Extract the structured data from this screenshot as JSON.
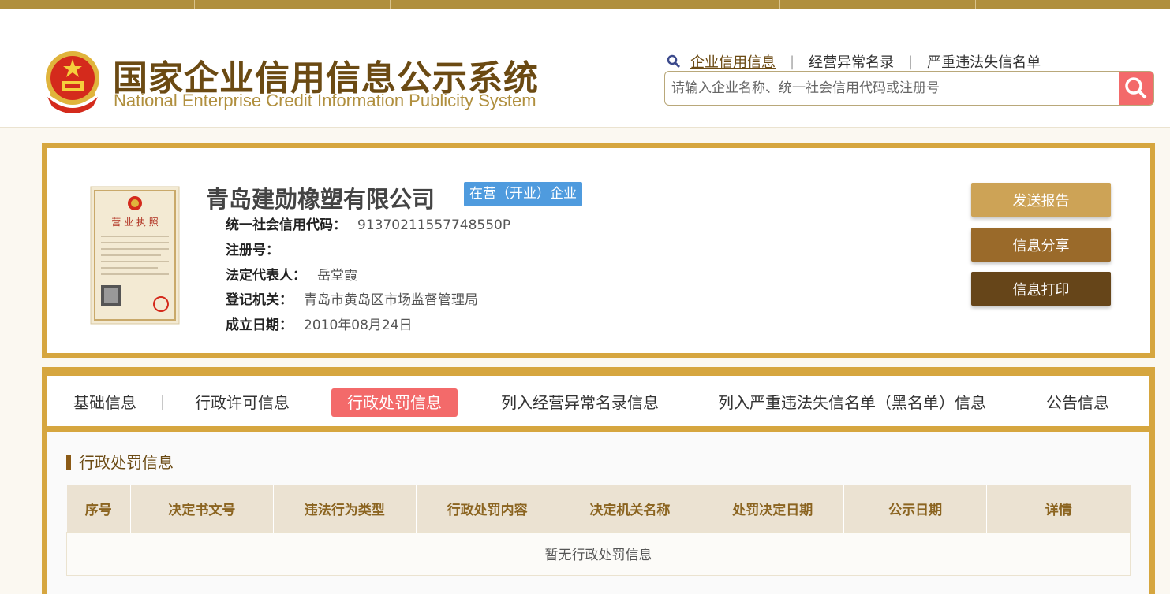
{
  "header": {
    "title_cn": "国家企业信用信息公示系统",
    "title_en": "National Enterprise Credit Information Publicity System",
    "search_tabs": [
      {
        "label": "企业信用信息",
        "active": true
      },
      {
        "label": "经营异常名录",
        "active": false
      },
      {
        "label": "严重违法失信名单",
        "active": false
      }
    ],
    "search_placeholder": "请输入企业名称、统一社会信用代码或注册号"
  },
  "company": {
    "name": "青岛建勋橡塑有限公司",
    "status": "在营（开业）企业",
    "fields": [
      {
        "key": "统一社会信用代码：",
        "value": "91370211557748550P"
      },
      {
        "key": "注册号：",
        "value": ""
      },
      {
        "key": "法定代表人：",
        "value": "岳堂霞"
      },
      {
        "key": "登记机关：",
        "value": "青岛市黄岛区市场监督管理局"
      },
      {
        "key": "成立日期：",
        "value": "2010年08月24日"
      }
    ],
    "license_title": "营 业 执 照"
  },
  "actions": {
    "report": "发送报告",
    "share": "信息分享",
    "print": "信息打印"
  },
  "tabs": [
    {
      "label": "基础信息",
      "active": false
    },
    {
      "label": "行政许可信息",
      "active": false
    },
    {
      "label": "行政处罚信息",
      "active": true
    },
    {
      "label": "列入经营异常名录信息",
      "active": false
    },
    {
      "label": "列入严重违法失信名单（黑名单）信息",
      "active": false
    },
    {
      "label": "公告信息",
      "active": false
    }
  ],
  "section": {
    "title": "行政处罚信息",
    "columns": [
      "序号",
      "决定书文号",
      "违法行为类型",
      "行政处罚内容",
      "决定机关名称",
      "处罚决定日期",
      "公示日期",
      "详情"
    ],
    "empty_text": "暂无行政处罚信息"
  },
  "colors": {
    "gold": "#d6a63f",
    "brown": "#6b4a13",
    "accent_red": "#f36a6a",
    "badge_blue": "#4f9bde"
  }
}
